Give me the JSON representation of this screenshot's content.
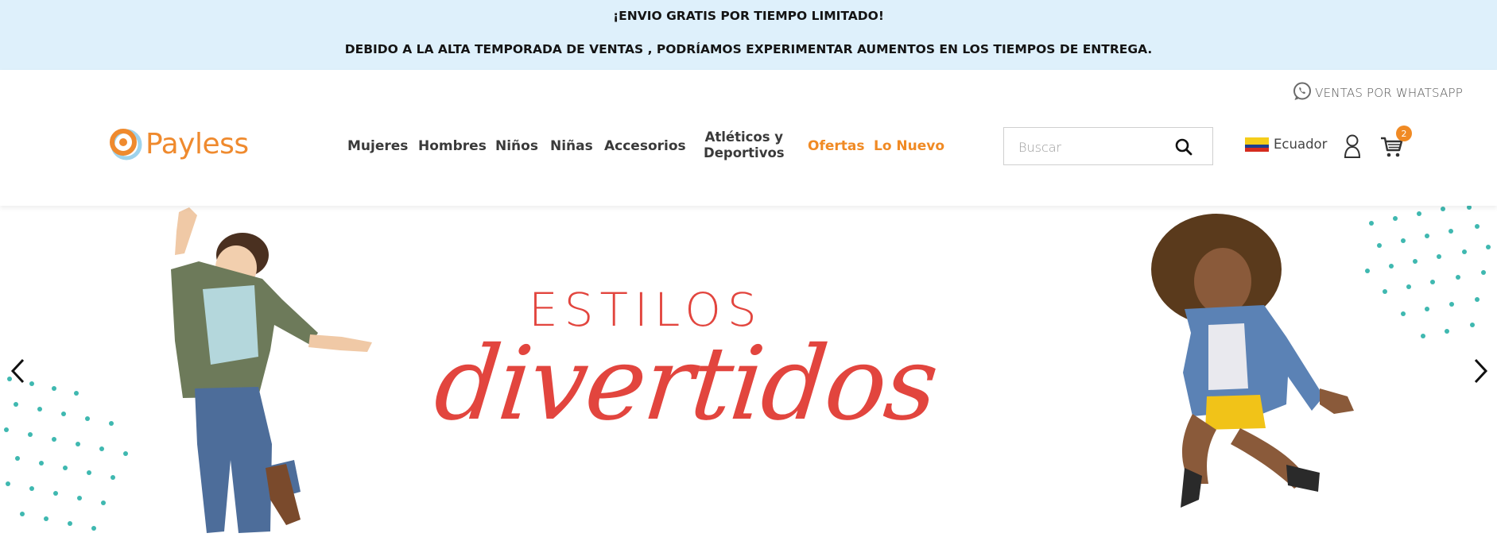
{
  "promo": {
    "line1": "¡ENVIO GRATIS POR TIEMPO LIMITADO!",
    "line2": "DEBIDO A LA ALTA TEMPORADA DE VENTAS , PODRÍAMOS EXPERIMENTAR AUMENTOS EN LOS TIEMPOS DE ENTREGA."
  },
  "header": {
    "whatsapp_label": "VENTAS POR WHATSAPP",
    "logo_text": "Payless",
    "nav": {
      "mujeres": "Mujeres",
      "hombres": "Hombres",
      "ninos": "Niños",
      "ninas": "Niñas",
      "accesorios": "Accesorios",
      "atleticos_1": "Atléticos y",
      "atleticos_2": "Deportivos",
      "ofertas": "Ofertas",
      "lo_nuevo": "Lo Nuevo"
    },
    "search_placeholder": "Buscar",
    "country": "Ecuador",
    "cart_count": "2"
  },
  "hero": {
    "title_line1": "ESTILOS",
    "title_line2": "divertidos"
  },
  "colors": {
    "brand_orange": "#f08a24",
    "promo_bg": "#def0fb",
    "hero_red": "#e2453e",
    "dot_teal": "#3fb8b0"
  },
  "icons": {
    "whatsapp": "whatsapp-icon",
    "search": "search-icon",
    "user": "user-icon",
    "cart": "cart-icon",
    "prev": "chevron-left-icon",
    "next": "chevron-right-icon"
  }
}
